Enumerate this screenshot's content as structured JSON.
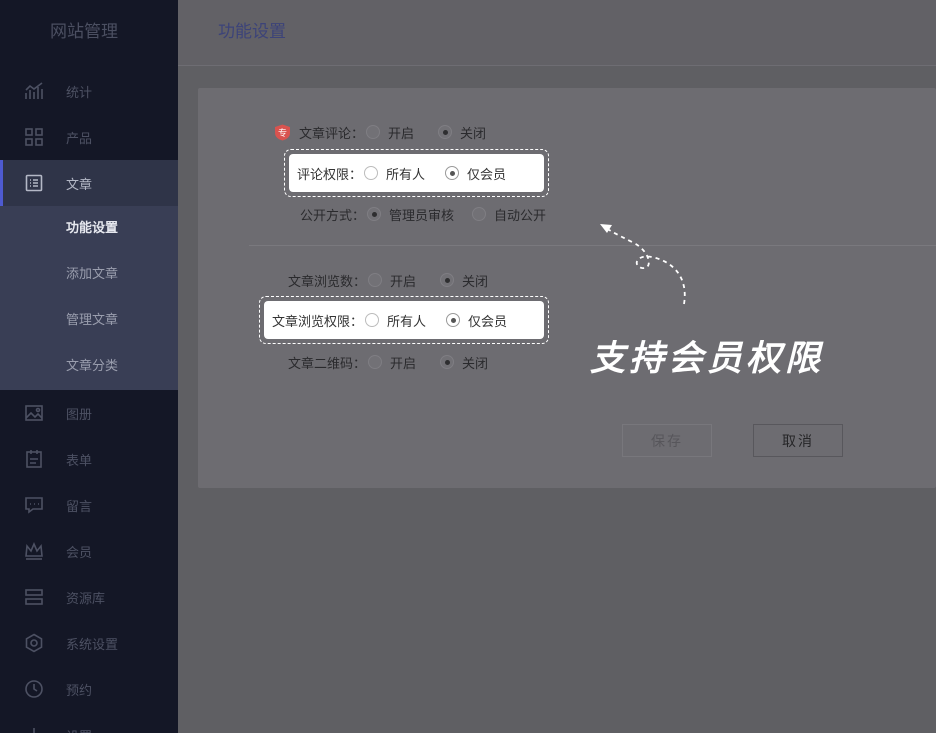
{
  "sidebar": {
    "brand": "网站管理",
    "items": [
      {
        "label": "统计",
        "icon": "stats-chart-icon"
      },
      {
        "label": "产品",
        "icon": "grid-icon"
      },
      {
        "label": "文章",
        "icon": "article-list-icon"
      },
      {
        "label": "图册",
        "icon": "image-icon"
      },
      {
        "label": "表单",
        "icon": "form-icon"
      },
      {
        "label": "留言",
        "icon": "message-icon"
      },
      {
        "label": "会员",
        "icon": "crown-icon"
      },
      {
        "label": "资源库",
        "icon": "library-icon"
      },
      {
        "label": "系统设置",
        "icon": "settings-icon"
      },
      {
        "label": "预约",
        "icon": "clock-icon"
      },
      {
        "label": "设置",
        "icon": "plus-icon"
      }
    ],
    "sub_items": [
      "功能设置",
      "添加文章",
      "管理文章",
      "文章分类"
    ]
  },
  "header": {
    "title": "功能设置"
  },
  "form": {
    "comment": {
      "label": "文章评论：",
      "options": [
        "开启",
        "关闭"
      ],
      "selected": "关闭"
    },
    "comment_permission": {
      "label": "评论权限：",
      "options": [
        "所有人",
        "仅会员"
      ],
      "selected": "仅会员"
    },
    "publish_mode": {
      "label": "公开方式：",
      "options": [
        "管理员审核",
        "自动公开"
      ],
      "selected": "管理员审核"
    },
    "view_count": {
      "label": "文章浏览数：",
      "options": [
        "开启",
        "关闭"
      ],
      "selected": "关闭"
    },
    "view_permission": {
      "label": "文章浏览权限：",
      "options": [
        "所有人",
        "仅会员"
      ],
      "selected": "仅会员"
    },
    "qrcode": {
      "label": "文章二维码：",
      "options": [
        "开启",
        "关闭"
      ],
      "selected": "关闭"
    }
  },
  "buttons": {
    "save": "保存",
    "cancel": "取消"
  },
  "callout": "支持会员权限",
  "badge_text": "专",
  "colors": {
    "accent": "#4e5ad0",
    "badge": "#d9534f"
  }
}
